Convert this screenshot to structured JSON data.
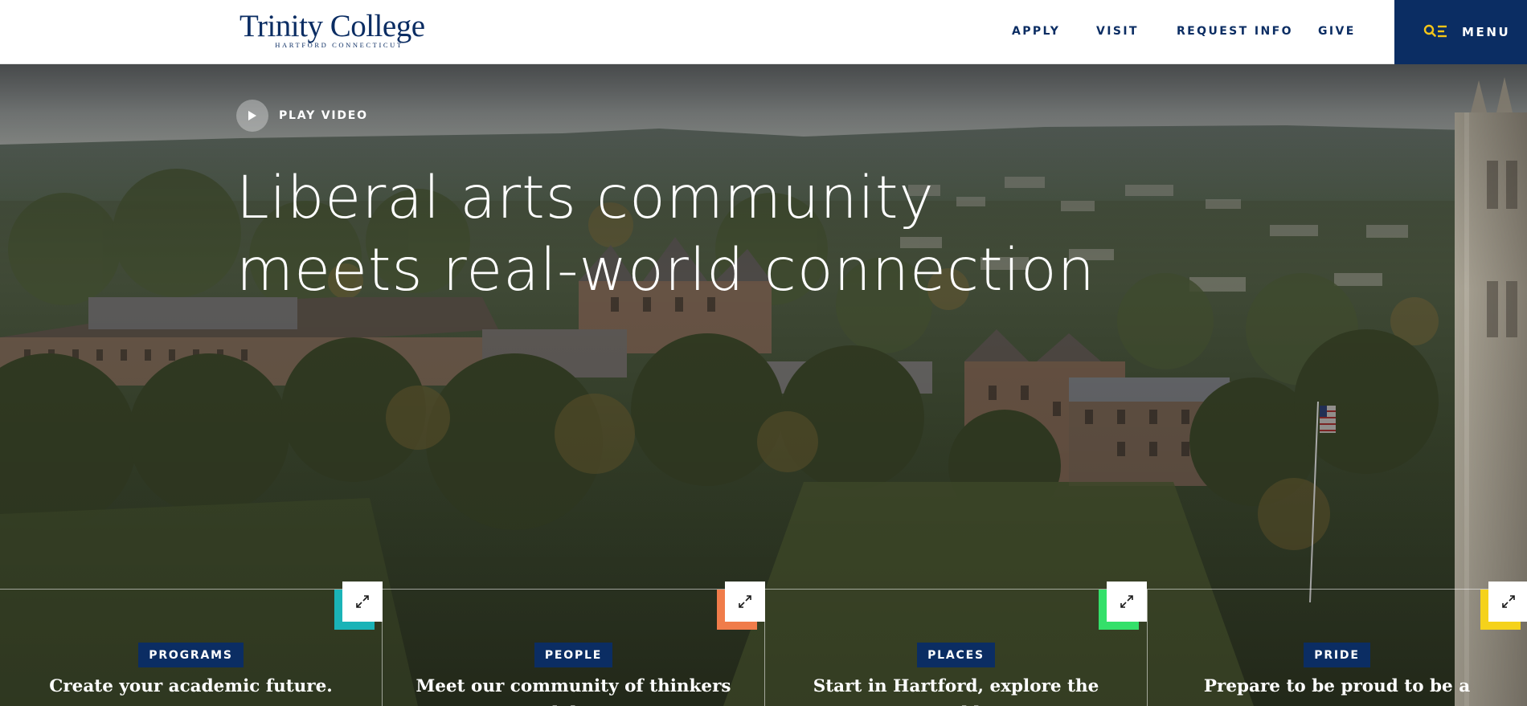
{
  "header": {
    "logo": {
      "name": "Trinity College",
      "location": "HARTFORD CONNECTICUT"
    },
    "nav": [
      {
        "label": "APPLY"
      },
      {
        "label": "VISIT"
      },
      {
        "label": "REQUEST INFO"
      },
      {
        "label": "GIVE"
      }
    ],
    "menu": {
      "label": "MENU",
      "icon": "search-menu-icon"
    }
  },
  "hero": {
    "play_video_label": "PLAY VIDEO",
    "headline_line1": "Liberal arts community",
    "headline_line2": "meets real-world connection",
    "background": "aerial-campus-photo"
  },
  "cards": [
    {
      "tag": "PROGRAMS",
      "title": "Create your academic future.",
      "accent": "#1ab3b7",
      "icon": "expand-icon"
    },
    {
      "tag": "PEOPLE",
      "title": "Meet our community of thinkers and doers.",
      "accent": "#f07c4a",
      "icon": "expand-icon"
    },
    {
      "tag": "PLACES",
      "title": "Start in Hartford, explore the world.",
      "accent": "#34e06a",
      "icon": "expand-icon"
    },
    {
      "tag": "PRIDE",
      "title": "Prepare to be proud to be a Bantam.",
      "accent": "#f5d21b",
      "icon": "expand-icon"
    }
  ],
  "colors": {
    "brand_navy": "#0b2d63",
    "header_bg": "#ffffff"
  }
}
